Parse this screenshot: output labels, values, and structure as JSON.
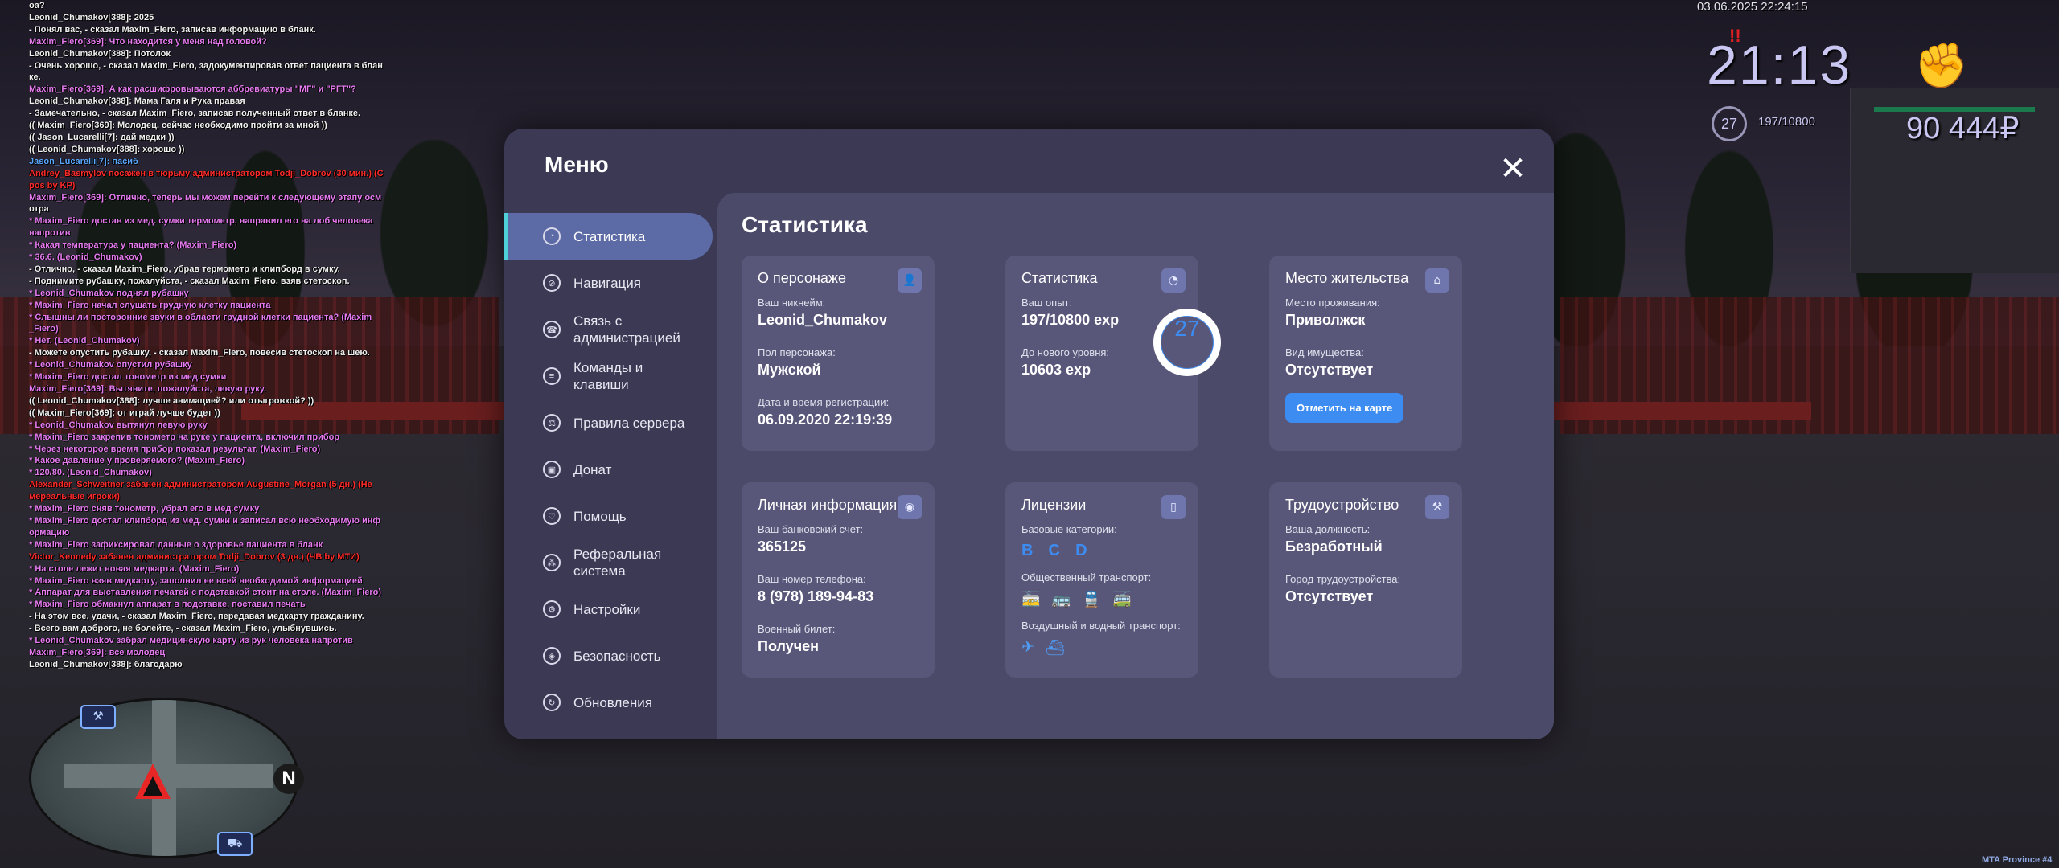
{
  "chat": [
    {
      "text": "оа?",
      "c": ""
    },
    {
      "text": "Leonid_Chumakov[388]: 2025",
      "c": ""
    },
    {
      "text": "- Понял вас, - сказал Maxim_Fiero, записав информацию в бланк.",
      "c": ""
    },
    {
      "text": "Maxim_Fiero[369]: Что находится у меня над головой?",
      "c": "pink"
    },
    {
      "text": "Leonid_Chumakov[388]: Потолок",
      "c": ""
    },
    {
      "text": "- Очень хорошо, - сказал Maxim_Fiero, задокументировав ответ пациента в блан",
      "c": ""
    },
    {
      "text": "ке.",
      "c": ""
    },
    {
      "text": "Maxim_Fiero[369]: А как расшифровываются аббревиатуры \"МГ\" и \"РГТ\"?",
      "c": "pink"
    },
    {
      "text": "Leonid_Chumakov[388]: Мама Галя и Рука правая",
      "c": ""
    },
    {
      "text": "- Замечательно, - сказал Maxim_Fiero, записав полученный ответ в бланке.",
      "c": ""
    },
    {
      "text": "(( Maxim_Fiero[369]: Молодец, сейчас необходимо пройти за мной ))",
      "c": ""
    },
    {
      "text": "(( Jason_Lucarelli[7]: дай медки ))",
      "c": ""
    },
    {
      "text": "(( Leonid_Chumakov[388]: хорошо ))",
      "c": ""
    },
    {
      "text": "Jason_Lucarelli[7]: пасиб",
      "c": "blue"
    },
    {
      "text": "Andrey_Basmylov посажен в тюрьму администратором Todji_Dobrov (30 мин.) (C",
      "c": "red"
    },
    {
      "text": "pos by KP)",
      "c": "red"
    },
    {
      "text": "Maxim_Fiero[369]: Отлично, теперь мы можем перейти к следующему этапу осм",
      "c": "pink"
    },
    {
      "text": "отра",
      "c": ""
    },
    {
      "text": "* Maxim_Fiero достав из мед. сумки термометр, направил его на лоб человека",
      "c": "pink"
    },
    {
      "text": "напротив",
      "c": "pink"
    },
    {
      "text": "* Какая температура у пациента? (Maxim_Fiero)",
      "c": "pink"
    },
    {
      "text": "* 36.6. (Leonid_Chumakov)",
      "c": "pink"
    },
    {
      "text": "- Отлично, - сказал Maxim_Fiero, убрав термометр и клипборд в сумку.",
      "c": ""
    },
    {
      "text": "- Поднимите рубашку, пожалуйста, - сказал Maxim_Fiero, взяв стетоскоп.",
      "c": ""
    },
    {
      "text": "* Leonid_Chumakov поднял рубашку",
      "c": "pink"
    },
    {
      "text": "* Maxim_Fiero начал слушать грудную клетку пациента",
      "c": "pink"
    },
    {
      "text": "* Слышны ли посторонние звуки в области грудной клетки пациента? (Maxim",
      "c": "pink"
    },
    {
      "text": "_Fiero)",
      "c": "pink"
    },
    {
      "text": "* Нет. (Leonid_Chumakov)",
      "c": "pink"
    },
    {
      "text": "- Можете опустить рубашку, - сказал Maxim_Fiero, повесив стетоскоп на шею.",
      "c": ""
    },
    {
      "text": "* Leonid_Chumakov опустил рубашку",
      "c": "pink"
    },
    {
      "text": "* Maxim_Fiero достал тонометр из мед.сумки",
      "c": "pink"
    },
    {
      "text": "Maxim_Fiero[369]: Вытяните, пожалуйста, левую руку.",
      "c": "pink"
    },
    {
      "text": "(( Leonid_Chumakov[388]: лучше анимацией? или отыгровкой? ))",
      "c": ""
    },
    {
      "text": "(( Maxim_Fiero[369]: от играй лучше будет ))",
      "c": ""
    },
    {
      "text": "* Leonid_Chumakov вытянул левую руку",
      "c": "pink"
    },
    {
      "text": "* Maxim_Fiero закрепив тонометр на руке у пациента, включил прибор",
      "c": "pink"
    },
    {
      "text": "* Через некоторое время прибор показал результат. (Maxim_Fiero)",
      "c": "pink"
    },
    {
      "text": "* Какое давление у проверяемого? (Maxim_Fiero)",
      "c": "pink"
    },
    {
      "text": "* 120/80. (Leonid_Chumakov)",
      "c": "pink"
    },
    {
      "text": "Alexander_Schweitner забанен администратором Augustine_Morgan (5 дн.) (Не",
      "c": "red"
    },
    {
      "text": "мереальные игроки)",
      "c": "red"
    },
    {
      "text": "* Maxim_Fiero сняв тонометр, убрал его в мед.сумку",
      "c": "pink"
    },
    {
      "text": "* Maxim_Fiero достал клипборд из мед. сумки и записал всю необходимую инф",
      "c": "pink"
    },
    {
      "text": "ормацию",
      "c": "pink"
    },
    {
      "text": "* Maxim_Fiero зафиксировал данные о здоровье пациента в бланк",
      "c": "pink"
    },
    {
      "text": "Victor_Kennedy забанен администратором Todji_Dobrov (3 дн.) (ЧВ by МТИ)",
      "c": "red"
    },
    {
      "text": "* На столе лежит новая медкарта. (Maxim_Fiero)",
      "c": "pink"
    },
    {
      "text": "* Maxim_Fiero взяв медкарту, заполнил ее всей необходимой информацией",
      "c": "pink"
    },
    {
      "text": "* Аппарат для выставления печатей с подставкой стоит на столе. (Maxim_Fiero)",
      "c": "pink"
    },
    {
      "text": "* Maxim_Fiero обмакнул аппарат в подставке, поставил печать",
      "c": "pink"
    },
    {
      "text": "- На этом все, удачи, - сказал Maxim_Fiero, передавая медкарту гражданину.",
      "c": ""
    },
    {
      "text": "- Всего вам доброго, не болейте, - сказал Maxim_Fiero, улыбнувшись.",
      "c": ""
    },
    {
      "text": "* Leonid_Chumakov забрал медицинскую карту из рук человека напротив",
      "c": "pink"
    },
    {
      "text": "Maxim_Fiero[369]: все молодец",
      "c": "pink"
    },
    {
      "text": "Leonid_Chumakov[388]: благодарю",
      "c": ""
    }
  ],
  "hud": {
    "date": "03.06.2025 22:24:15",
    "alert": "!!",
    "time": "21:13",
    "level": "27",
    "exp": "197/10800",
    "money": "90 444₽",
    "server": "MTA Province #4",
    "fist_icon": "fist-icon"
  },
  "minimap": {
    "north": "N"
  },
  "menu": {
    "title": "Меню",
    "close": "✕",
    "nav": [
      {
        "label": "Статистика",
        "icon": "◔",
        "active": true
      },
      {
        "label": "Навигация",
        "icon": "⊘"
      },
      {
        "label": "Связь с\nадминистрацией",
        "icon": "☎"
      },
      {
        "label": "Команды и\nклавиши",
        "icon": "≡"
      },
      {
        "label": "Правила сервера",
        "icon": "⚖"
      },
      {
        "label": "Донат",
        "icon": "▣"
      },
      {
        "label": "Помощь",
        "icon": "♡"
      },
      {
        "label": "Реферальная\nсистема",
        "icon": "⁂"
      },
      {
        "label": "Настройки",
        "icon": "⚙"
      },
      {
        "label": "Безопасность",
        "icon": "◈"
      },
      {
        "label": "Обновления",
        "icon": "↻"
      }
    ],
    "content_title": "Статистика",
    "cards": {
      "person": {
        "title": "О персонаже",
        "icon": "👤",
        "nick_label": "Ваш никнейм:",
        "nick": "Leonid_Chumakov",
        "sex_label": "Пол персонажа:",
        "sex": "Мужской",
        "reg_label": "Дата и время регистрации:",
        "reg": "06.09.2020 22:19:39"
      },
      "stats": {
        "title": "Статистика",
        "icon": "◔",
        "exp_label": "Ваш опыт:",
        "exp": "197/10800 exp",
        "next_label": "До нового уровня:",
        "next": "10603 exp",
        "level": "27"
      },
      "home": {
        "title": "Место жительства",
        "icon": "⌂",
        "place_label": "Место проживания:",
        "place": "Приволжск",
        "prop_label": "Вид имущества:",
        "prop": "Отсутствует",
        "map_button": "Отметить на карте"
      },
      "personal": {
        "title": "Личная информация",
        "icon": "◉",
        "bank_label": "Ваш банковский счет:",
        "bank": "365125",
        "phone_label": "Ваш номер телефона:",
        "phone": "8 (978) 189-94-83",
        "mil_label": "Военный билет:",
        "mil": "Получен"
      },
      "licenses": {
        "title": "Лицензии",
        "icon": "▯",
        "base_label": "Базовые категории:",
        "base": [
          "B",
          "C",
          "D"
        ],
        "public_label": "Общественный транспорт:",
        "air_label": "Воздушный и водный транспорт:"
      },
      "job": {
        "title": "Трудоустройство",
        "icon": "⚒",
        "pos_label": "Ваша должность:",
        "pos": "Безработный",
        "city_label": "Город трудоустройства:",
        "city": "Отсутствует"
      }
    }
  }
}
